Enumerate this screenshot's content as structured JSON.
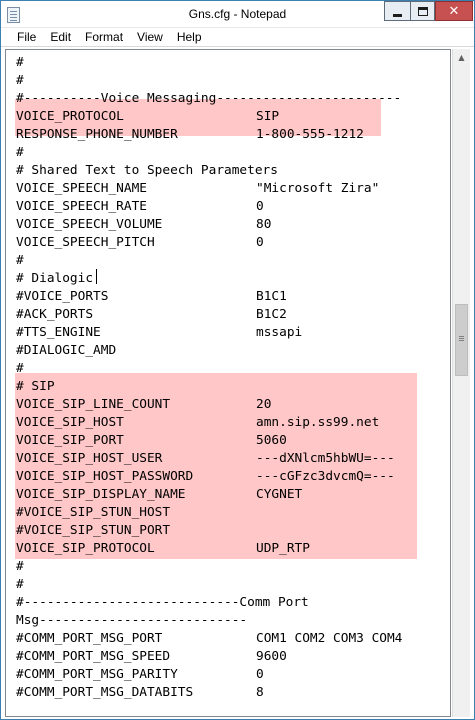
{
  "window": {
    "title": "Gns.cfg - Notepad",
    "close_glyph": "✕"
  },
  "menu": [
    "File",
    "Edit",
    "Format",
    "View",
    "Help"
  ],
  "highlight_color": "#ffc7c7",
  "icons": {
    "scroll_up": "▲"
  },
  "lines": [
    {
      "k": "#",
      "v": ""
    },
    {
      "k": "#",
      "v": ""
    },
    {
      "k": "#----------Voice Messaging------------------------",
      "v": ""
    },
    {
      "k": "VOICE_PROTOCOL",
      "v": "SIP"
    },
    {
      "k": "RESPONSE_PHONE_NUMBER",
      "v": "1-800-555-1212"
    },
    {
      "k": "#",
      "v": ""
    },
    {
      "k": "# Shared Text to Speech Parameters",
      "v": ""
    },
    {
      "k": "VOICE_SPEECH_NAME",
      "v": "\"Microsoft Zira\""
    },
    {
      "k": "VOICE_SPEECH_RATE",
      "v": "0"
    },
    {
      "k": "VOICE_SPEECH_VOLUME",
      "v": "80"
    },
    {
      "k": "VOICE_SPEECH_PITCH",
      "v": "0"
    },
    {
      "k": "#",
      "v": ""
    },
    {
      "k": "# Dialogic",
      "v": ""
    },
    {
      "k": "#VOICE_PORTS",
      "v": "B1C1"
    },
    {
      "k": "#ACK_PORTS",
      "v": "B1C2"
    },
    {
      "k": "#TTS_ENGINE",
      "v": "mssapi"
    },
    {
      "k": "#DIALOGIC_AMD",
      "v": ""
    },
    {
      "k": "#",
      "v": ""
    },
    {
      "k": "# SIP",
      "v": ""
    },
    {
      "k": "VOICE_SIP_LINE_COUNT",
      "v": "20"
    },
    {
      "k": "VOICE_SIP_HOST",
      "v": "amn.sip.ss99.net"
    },
    {
      "k": "VOICE_SIP_PORT",
      "v": "5060"
    },
    {
      "k": "VOICE_SIP_HOST_USER",
      "v": "---dXNlcm5hbWU=---"
    },
    {
      "k": "VOICE_SIP_HOST_PASSWORD",
      "v": "---cGFzc3dvcmQ=---"
    },
    {
      "k": "VOICE_SIP_DISPLAY_NAME",
      "v": "CYGNET"
    },
    {
      "k": "#VOICE_SIP_STUN_HOST",
      "v": ""
    },
    {
      "k": "#VOICE_SIP_STUN_PORT",
      "v": ""
    },
    {
      "k": "VOICE_SIP_PROTOCOL",
      "v": "UDP_RTP"
    },
    {
      "k": "#",
      "v": ""
    },
    {
      "k": "#",
      "v": ""
    },
    {
      "k": "#----------------------------Comm Port",
      "v": ""
    },
    {
      "k": "Msg---------------------------",
      "v": ""
    },
    {
      "k": "#COMM_PORT_MSG_PORT",
      "v": "COM1 COM2 COM3 COM4"
    },
    {
      "k": "#COMM_PORT_MSG_SPEED",
      "v": "9600"
    },
    {
      "k": "#COMM_PORT_MSG_PARITY",
      "v": "0"
    },
    {
      "k": "#COMM_PORT_MSG_DATABITS",
      "v": "8"
    }
  ]
}
